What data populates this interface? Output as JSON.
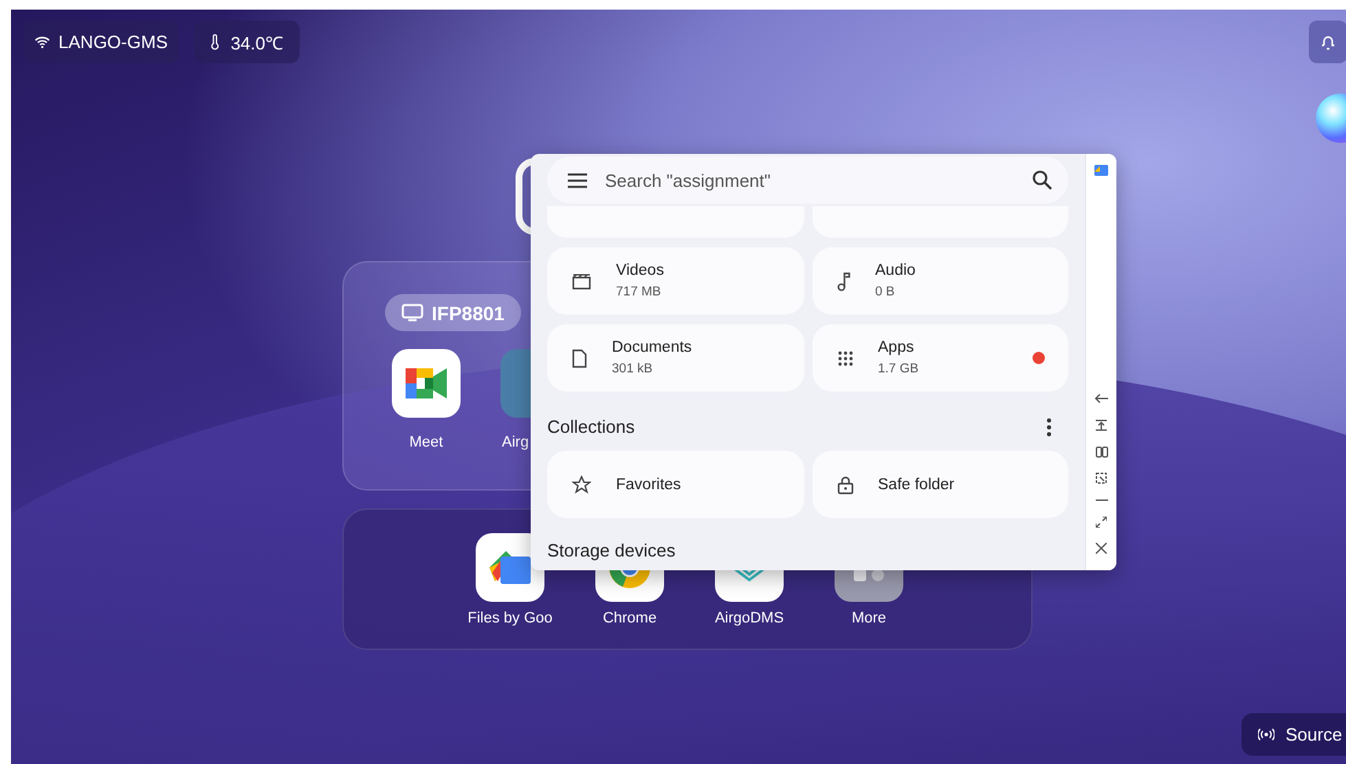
{
  "status": {
    "network": "LANGO-GMS",
    "temperature": "34.0℃"
  },
  "widget": {
    "device": "IFP8801",
    "apps": [
      {
        "label": "Meet",
        "kind": "meet"
      },
      {
        "label": "Airg",
        "kind": "airgo"
      }
    ]
  },
  "dock": {
    "apps": [
      {
        "label": "Files by Goo",
        "kind": "files"
      },
      {
        "label": "Chrome",
        "kind": "chrome"
      },
      {
        "label": "AirgoDMS",
        "kind": "airgodms"
      },
      {
        "label": "More",
        "kind": "more"
      }
    ]
  },
  "files_window": {
    "search": {
      "placeholder": "Search \"assignment\""
    },
    "categories": [
      {
        "kind": "videos",
        "name": "Videos",
        "size": "717 MB",
        "dot": false
      },
      {
        "kind": "audio",
        "name": "Audio",
        "size": "0 B",
        "dot": false
      },
      {
        "kind": "documents",
        "name": "Documents",
        "size": "301 kB",
        "dot": false
      },
      {
        "kind": "apps",
        "name": "Apps",
        "size": "1.7 GB",
        "dot": true
      }
    ],
    "collections_title": "Collections",
    "collections": [
      {
        "kind": "favorites",
        "name": "Favorites"
      },
      {
        "kind": "safe",
        "name": "Safe folder"
      }
    ],
    "storage_title": "Storage devices"
  },
  "source_button": "Source"
}
